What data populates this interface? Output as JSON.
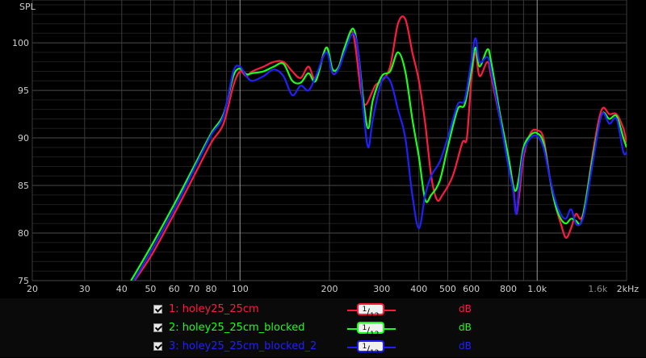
{
  "chart_data": {
    "type": "line",
    "ylabel": "SPL",
    "xlabel": "",
    "x_scale": "log",
    "xlim": [
      20,
      2000
    ],
    "ylim": [
      75,
      104.5
    ],
    "x_ticks": [
      {
        "v": 20,
        "label": "20"
      },
      {
        "v": 30,
        "label": "30"
      },
      {
        "v": 40,
        "label": "40"
      },
      {
        "v": 50,
        "label": "50"
      },
      {
        "v": 60,
        "label": "60"
      },
      {
        "v": 70,
        "label": "70"
      },
      {
        "v": 80,
        "label": "80"
      },
      {
        "v": 100,
        "label": "100"
      },
      {
        "v": 200,
        "label": "200"
      },
      {
        "v": 300,
        "label": "300"
      },
      {
        "v": 400,
        "label": "400"
      },
      {
        "v": 500,
        "label": "500"
      },
      {
        "v": 600,
        "label": "600"
      },
      {
        "v": 800,
        "label": "800"
      },
      {
        "v": 1000,
        "label": "1.0k"
      },
      {
        "v": 1600,
        "label": "1.6k"
      },
      {
        "v": 2000,
        "label": "2kHz"
      }
    ],
    "x_gridlines": [
      20,
      30,
      40,
      50,
      60,
      70,
      80,
      90,
      100,
      200,
      300,
      400,
      500,
      600,
      700,
      800,
      900,
      1000,
      2000
    ],
    "x_major": [
      100,
      1000
    ],
    "y_ticks": [
      75,
      80,
      85,
      90,
      95,
      100
    ],
    "grid": true,
    "series": [
      {
        "name": "1: holey25_25cm",
        "color": "#ff1a40",
        "points": [
          [
            43,
            74.5
          ],
          [
            50,
            77.5
          ],
          [
            60,
            82
          ],
          [
            70,
            86
          ],
          [
            80,
            89.5
          ],
          [
            88,
            91.5
          ],
          [
            95,
            95.5
          ],
          [
            100,
            97
          ],
          [
            105,
            96.5
          ],
          [
            110,
            97
          ],
          [
            120,
            97.5
          ],
          [
            130,
            98
          ],
          [
            140,
            98
          ],
          [
            150,
            97
          ],
          [
            160,
            96.3
          ],
          [
            170,
            97.5
          ],
          [
            180,
            96.2
          ],
          [
            195,
            99.5
          ],
          [
            205,
            96.8
          ],
          [
            215,
            97.5
          ],
          [
            225,
            99.5
          ],
          [
            240,
            101
          ],
          [
            255,
            95
          ],
          [
            265,
            93.5
          ],
          [
            285,
            95.5
          ],
          [
            300,
            96
          ],
          [
            320,
            97.5
          ],
          [
            340,
            102
          ],
          [
            360,
            102.5
          ],
          [
            380,
            99
          ],
          [
            400,
            96
          ],
          [
            420,
            91.5
          ],
          [
            440,
            86
          ],
          [
            460,
            83.5
          ],
          [
            480,
            84
          ],
          [
            520,
            86
          ],
          [
            560,
            89.5
          ],
          [
            580,
            90
          ],
          [
            600,
            96
          ],
          [
            620,
            99
          ],
          [
            640,
            96.5
          ],
          [
            680,
            98
          ],
          [
            700,
            96.5
          ],
          [
            750,
            92
          ],
          [
            800,
            88
          ],
          [
            830,
            85
          ],
          [
            850,
            82
          ],
          [
            870,
            84
          ],
          [
            900,
            88
          ],
          [
            950,
            90.5
          ],
          [
            1000,
            90.8
          ],
          [
            1050,
            90
          ],
          [
            1100,
            86
          ],
          [
            1150,
            83
          ],
          [
            1200,
            81
          ],
          [
            1250,
            79.5
          ],
          [
            1300,
            80.5
          ],
          [
            1350,
            82
          ],
          [
            1400,
            81.5
          ],
          [
            1450,
            83
          ],
          [
            1550,
            89
          ],
          [
            1650,
            93
          ],
          [
            1750,
            92.5
          ],
          [
            1850,
            92.5
          ],
          [
            1950,
            91
          ],
          [
            2000,
            89.5
          ]
        ]
      },
      {
        "name": "2: holey25_25cm_blocked",
        "color": "#1aff1a",
        "points": [
          [
            43,
            75
          ],
          [
            50,
            78.5
          ],
          [
            60,
            83
          ],
          [
            70,
            87
          ],
          [
            80,
            90.5
          ],
          [
            88,
            92.5
          ],
          [
            95,
            96.5
          ],
          [
            100,
            97.3
          ],
          [
            105,
            96.7
          ],
          [
            110,
            96.8
          ],
          [
            120,
            97
          ],
          [
            130,
            97.5
          ],
          [
            140,
            97.8
          ],
          [
            150,
            96
          ],
          [
            160,
            95.8
          ],
          [
            170,
            96.8
          ],
          [
            180,
            96
          ],
          [
            195,
            99.5
          ],
          [
            205,
            97.2
          ],
          [
            215,
            97.5
          ],
          [
            225,
            99.5
          ],
          [
            240,
            101.5
          ],
          [
            250,
            99
          ],
          [
            260,
            94
          ],
          [
            270,
            91
          ],
          [
            280,
            94
          ],
          [
            300,
            96.5
          ],
          [
            320,
            97
          ],
          [
            340,
            99
          ],
          [
            360,
            97
          ],
          [
            380,
            92
          ],
          [
            400,
            88
          ],
          [
            420,
            83.5
          ],
          [
            440,
            84
          ],
          [
            470,
            85.5
          ],
          [
            500,
            89
          ],
          [
            540,
            93
          ],
          [
            570,
            93.5
          ],
          [
            600,
            97
          ],
          [
            620,
            99.5
          ],
          [
            640,
            97.5
          ],
          [
            680,
            99.3
          ],
          [
            700,
            98
          ],
          [
            750,
            92.5
          ],
          [
            800,
            88
          ],
          [
            830,
            85
          ],
          [
            850,
            84.5
          ],
          [
            870,
            86
          ],
          [
            900,
            89
          ],
          [
            950,
            90.3
          ],
          [
            1000,
            90.5
          ],
          [
            1050,
            89.5
          ],
          [
            1100,
            86
          ],
          [
            1150,
            83
          ],
          [
            1200,
            81.5
          ],
          [
            1250,
            81
          ],
          [
            1300,
            81.5
          ],
          [
            1350,
            81.3
          ],
          [
            1400,
            81
          ],
          [
            1450,
            83
          ],
          [
            1550,
            88.5
          ],
          [
            1650,
            92.5
          ],
          [
            1750,
            92
          ],
          [
            1850,
            92.3
          ],
          [
            1950,
            90
          ],
          [
            2000,
            89
          ]
        ]
      },
      {
        "name": "3: holey25_25cm_blocked_2",
        "color": "#2020ff",
        "points": [
          [
            43,
            74.5
          ],
          [
            50,
            78
          ],
          [
            60,
            82.5
          ],
          [
            70,
            86.7
          ],
          [
            80,
            90.3
          ],
          [
            88,
            92.3
          ],
          [
            95,
            97
          ],
          [
            100,
            97.5
          ],
          [
            105,
            96.5
          ],
          [
            110,
            96
          ],
          [
            120,
            96.5
          ],
          [
            130,
            97.2
          ],
          [
            140,
            96.5
          ],
          [
            150,
            94.5
          ],
          [
            160,
            95.5
          ],
          [
            170,
            95
          ],
          [
            180,
            96.5
          ],
          [
            195,
            99
          ],
          [
            205,
            96.8
          ],
          [
            215,
            97.3
          ],
          [
            225,
            99
          ],
          [
            240,
            101
          ],
          [
            250,
            99
          ],
          [
            260,
            93
          ],
          [
            270,
            89
          ],
          [
            280,
            92
          ],
          [
            300,
            96
          ],
          [
            320,
            96
          ],
          [
            340,
            93
          ],
          [
            360,
            90
          ],
          [
            380,
            84
          ],
          [
            400,
            80.5
          ],
          [
            420,
            84
          ],
          [
            440,
            86
          ],
          [
            470,
            87.5
          ],
          [
            500,
            90
          ],
          [
            540,
            93.5
          ],
          [
            570,
            94
          ],
          [
            600,
            98
          ],
          [
            620,
            100.5
          ],
          [
            640,
            98
          ],
          [
            680,
            98.5
          ],
          [
            700,
            97
          ],
          [
            750,
            92
          ],
          [
            800,
            87
          ],
          [
            830,
            84.5
          ],
          [
            850,
            82
          ],
          [
            870,
            85
          ],
          [
            900,
            88.5
          ],
          [
            950,
            90
          ],
          [
            1000,
            90.2
          ],
          [
            1050,
            89
          ],
          [
            1100,
            86
          ],
          [
            1150,
            83.5
          ],
          [
            1200,
            82
          ],
          [
            1250,
            81.5
          ],
          [
            1300,
            82.5
          ],
          [
            1350,
            81
          ],
          [
            1400,
            81
          ],
          [
            1450,
            82.5
          ],
          [
            1550,
            88
          ],
          [
            1650,
            92.5
          ],
          [
            1750,
            91.5
          ],
          [
            1850,
            92
          ],
          [
            1950,
            88.5
          ],
          [
            2000,
            88.5
          ]
        ]
      }
    ]
  },
  "legend": [
    {
      "name": "1: holey25_25cm",
      "color": "#ff1a40",
      "smoothing_num": "1",
      "smoothing_den": "12",
      "unit": "dB"
    },
    {
      "name": "2: holey25_25cm_blocked",
      "color": "#1aff1a",
      "smoothing_num": "1",
      "smoothing_den": "12",
      "unit": "dB"
    },
    {
      "name": "3: holey25_25cm_blocked_2",
      "color": "#2020ff",
      "smoothing_num": "1",
      "smoothing_den": "12",
      "unit": "dB"
    }
  ]
}
